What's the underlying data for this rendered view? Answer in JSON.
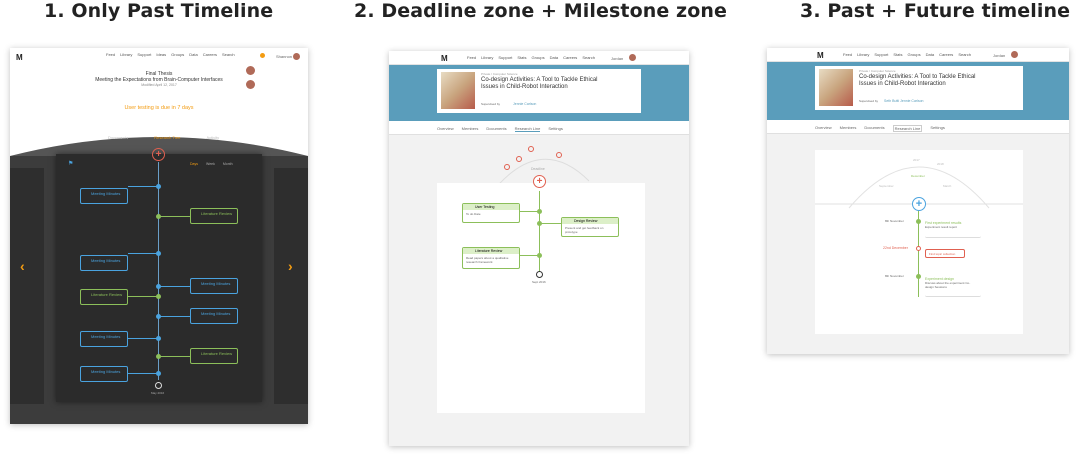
{
  "titles": [
    "1. Only Past Timeline",
    "2. Deadline zone + Milestone zone",
    "3. Past + Future timeline"
  ],
  "nav_links": [
    "Feed",
    "Library",
    "Support",
    "Ideas",
    "Groups",
    "Data",
    "Careers"
  ],
  "nav_links_short": [
    "Feed",
    "Library",
    "Support",
    "Stats",
    "Groups",
    "Data",
    "Careers"
  ],
  "search_label": "Search",
  "panel1": {
    "user_name": "Shannon",
    "title_line1": "Final Thesis",
    "title_line2": "Meeting the Expectations from Brain-Computer Interfaces",
    "date": "Modified April 12, 2017",
    "alert": "User testing is due in 7 days",
    "tabs": [
      "Documents",
      "Research Tree",
      "Activity"
    ],
    "view_toggle": [
      "Days",
      "Week",
      "Month"
    ],
    "cards": [
      {
        "title": "Meeting Minutes",
        "side": "left"
      },
      {
        "title": "Literature Review",
        "side": "right"
      },
      {
        "title": "Meeting Minutes",
        "side": "left"
      },
      {
        "title": "Literature Review",
        "side": "left"
      },
      {
        "title": "Meeting Minutes",
        "side": "right"
      },
      {
        "title": "Meeting Minutes",
        "side": "right"
      },
      {
        "title": "Meeting Minutes",
        "side": "left"
      },
      {
        "title": "Literature Review",
        "side": "right"
      },
      {
        "title": "Meeting Minutes",
        "side": "left"
      }
    ],
    "end_label": "May 2016"
  },
  "panel2": {
    "user_name": "Jordan",
    "breadcrumb": "Private / Computer Science",
    "project_title": "Co-design Activities: A Tool to Tackle Ethical Issues in Child-Robot Interaction",
    "supervised_label": "Supervised by",
    "supervisor": "Jennie Carlson",
    "tabs": [
      "Overview",
      "Members",
      "Documents",
      "Research Line",
      "Settings"
    ],
    "timeline_label": "Deadline",
    "cards": [
      {
        "title": "User Testing",
        "body": "To do Date"
      },
      {
        "title": "Design Review",
        "body": "Present and get feedback on prototype"
      },
      {
        "title": "Literature Review",
        "body": "Read papers about a qualitative research framework"
      }
    ],
    "end_label": "Sept 2016"
  },
  "panel3": {
    "user_name": "Jordan",
    "breadcrumb": "Private / Computer Science",
    "project_title": "Co-design Activities: A Tool to Tackle Ethical Issues in Child-Robot Interaction",
    "supervised_label": "Supervised by",
    "supervisors": "Seth Butti  Jennie Carlson",
    "tabs": [
      "Overview",
      "Members",
      "Documents",
      "Research Line",
      "Settings"
    ],
    "arc_labels": [
      "2017",
      "2018",
      "December",
      "September",
      "March"
    ],
    "events": [
      {
        "label": "First experiment results",
        "body": "Experiment result report"
      },
      {
        "label": "Find topic collection",
        "body": ""
      },
      {
        "label": "Experiment design",
        "body": "Discuss about the experiment Co-design Sessions"
      }
    ],
    "side_labels": [
      "8th November",
      "22nd December",
      "8th November"
    ]
  },
  "colors": {
    "accent_orange": "#f39c12",
    "teal_header": "#5a9dbb",
    "dark_bg": "#3c3c3c",
    "green": "#8cbf5a",
    "blue_line": "#4aa3df",
    "red": "#e06050"
  }
}
